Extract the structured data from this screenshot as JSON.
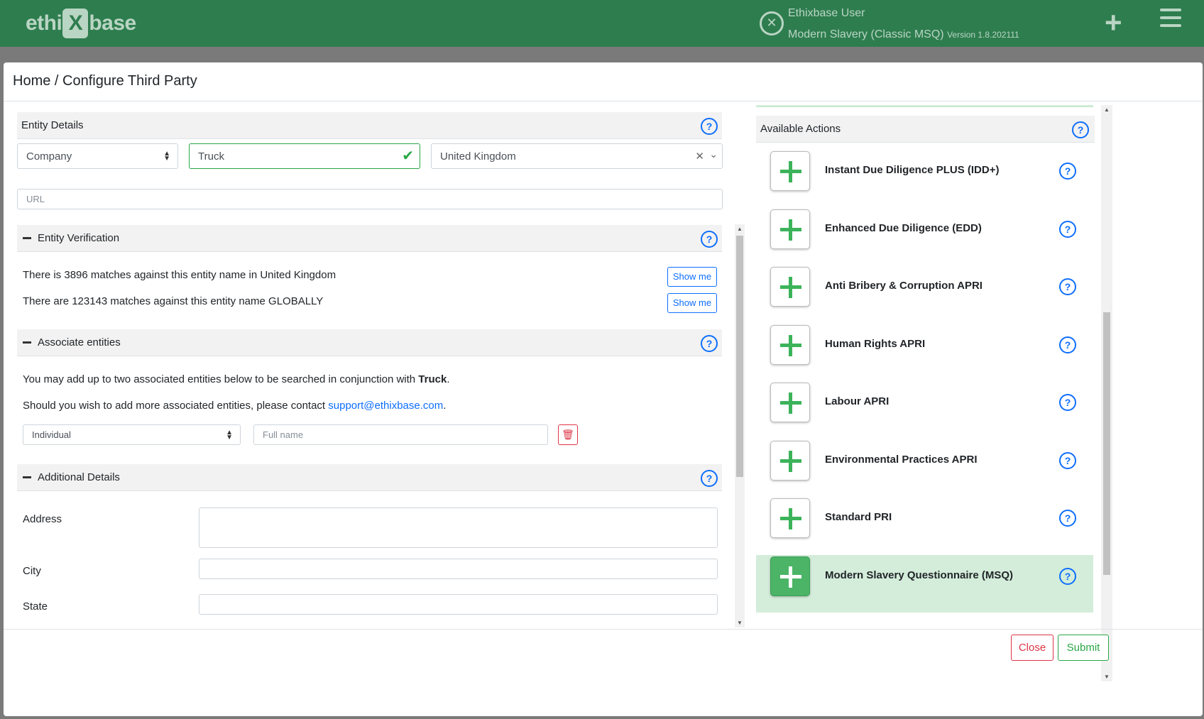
{
  "app": {
    "logo_left": "ethi",
    "logo_x": "X",
    "logo_right": "base",
    "user_name": "Ethixbase User",
    "module": "Modern Slavery (Classic MSQ)",
    "version": "Version 1.8.202111"
  },
  "modal": {
    "title": "Home / Configure Third Party"
  },
  "entity_details": {
    "heading": "Entity Details",
    "entity_type": "Company",
    "entity_name": "Truck",
    "country": "United Kingdom",
    "url_placeholder": "URL"
  },
  "entity_verification": {
    "heading": "Entity Verification",
    "local_match_text": "There is 3896 matches against this entity name in United Kingdom",
    "global_match_text": "There are 123143 matches against this entity name GLOBALLY",
    "show_me_label": "Show me"
  },
  "associate_entities": {
    "heading": "Associate entities",
    "intro_prefix": "You may add up to two associated entities below to be searched in conjunction with ",
    "intro_entity": "Truck",
    "intro_suffix": ".",
    "contact_prefix": "Should you wish to add more associated entities, please contact ",
    "contact_email": "support@ethixbase.com",
    "contact_suffix": ".",
    "type_value": "Individual",
    "name_placeholder": "Full name"
  },
  "additional_details": {
    "heading": "Additional Details",
    "address_label": "Address",
    "city_label": "City",
    "state_label": "State"
  },
  "available_actions": {
    "heading": "Available Actions",
    "items": [
      {
        "label": "Instant Due Diligence PLUS (IDD+)",
        "selected": false
      },
      {
        "label": "Enhanced Due Diligence (EDD)",
        "selected": false
      },
      {
        "label": "Anti Bribery & Corruption APRI",
        "selected": false
      },
      {
        "label": "Human Rights APRI",
        "selected": false
      },
      {
        "label": "Labour APRI",
        "selected": false
      },
      {
        "label": "Environmental Practices APRI",
        "selected": false
      },
      {
        "label": "Standard PRI",
        "selected": false
      },
      {
        "label": "Modern Slavery Questionnaire (MSQ)",
        "selected": true
      }
    ]
  },
  "footer": {
    "close_label": "Close",
    "submit_label": "Submit"
  },
  "colors": {
    "brand_green": "#2e7d4f",
    "selected_bg": "#d4edda",
    "link_blue": "#0d6efd",
    "danger": "#dc3545",
    "success": "#28a745"
  }
}
